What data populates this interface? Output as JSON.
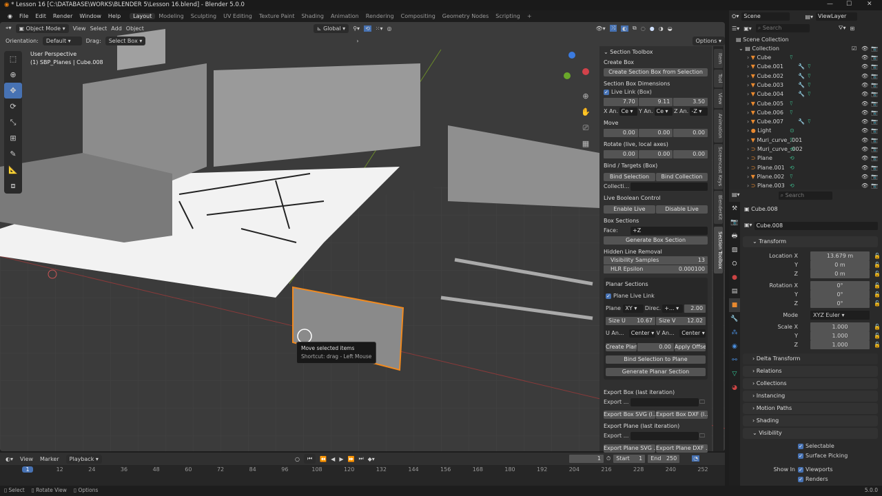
{
  "title": "* Lesson 16 [C:\\DATABASE\\WORKS\\BLENDER 5\\Lesson 16.blend] - Blender 5.0.0",
  "menu": [
    "File",
    "Edit",
    "Render",
    "Window",
    "Help"
  ],
  "workspaces": [
    "Layout",
    "Modeling",
    "Sculpting",
    "UV Editing",
    "Texture Paint",
    "Shading",
    "Animation",
    "Rendering",
    "Compositing",
    "Geometry Nodes",
    "Scripting",
    "+"
  ],
  "viewport": {
    "mode": "Object Mode",
    "menus": [
      "View",
      "Select",
      "Add",
      "Object"
    ],
    "transform_orientation": "Global",
    "orientation_label": "Orientation:",
    "orientation_value": "Default",
    "drag_label": "Drag:",
    "drag_value": "Select Box",
    "options": "Options",
    "view_name": "User Perspective",
    "view_info": "(1) SBP_Planes | Cube.008",
    "tooltip_title": "Move selected items",
    "tooltip_shortcut": "Shortcut: drag - Left Mouse"
  },
  "section_toolbox": {
    "title": "Section Toolbox",
    "create_box": "Create Box",
    "create_box_btn": "Create Section Box from Selection",
    "dims": "Section Box Dimensions",
    "live_link": "Live Link (Box)",
    "dim_values": [
      "7.70",
      "9.11",
      "3.50"
    ],
    "anchors": [
      {
        "label": "X An...",
        "value": "Ce"
      },
      {
        "label": "Y An...",
        "value": "Ce"
      },
      {
        "label": "Z An...",
        "value": "-Z"
      }
    ],
    "move": "Move",
    "move_values": [
      "0.00",
      "0.00",
      "0.00"
    ],
    "rotate": "Rotate (live, local axes)",
    "rotate_values": [
      "0.00",
      "0.00",
      "0.00"
    ],
    "bind": "Bind / Targets (Box)",
    "bind_selection": "Bind Selection",
    "bind_collection": "Bind Collection",
    "collection_label": "Collecti...",
    "live_bool": "Live Boolean Control",
    "enable_live": "Enable Live",
    "disable_live": "Disable Live",
    "box_sections": "Box Sections",
    "face_label": "Face:",
    "face_value": "+Z",
    "gen_box": "Generate Box Section",
    "hlr": "Hidden Line Removal",
    "vis_samples_label": "Visibility Samples",
    "vis_samples": "13",
    "hlr_eps_label": "HLR Epsilon",
    "hlr_eps": "0.000100",
    "planar": "Planar Sections",
    "plane_live": "Plane Live Link",
    "plane_label": "Plane:",
    "plane_value": "XY",
    "direc_label": "Direc...",
    "direc_value": "+...",
    "plane_offset": "2.00",
    "size_u_label": "Size U",
    "size_u": "10.67",
    "size_v_label": "Size V",
    "size_v": "12.02",
    "u_an": "U An...",
    "u_an_value": "Center",
    "v_an": "V An...",
    "v_an_value": "Center",
    "create_plane": "Create Plane",
    "create_plane_val": "0.00",
    "apply_offset": "Apply Offset",
    "bind_plane": "Bind Selection to Plane",
    "gen_planar": "Generate Planar Section",
    "export_box": "Export Box (last iteration)",
    "export_label": "Export ...",
    "export_box_svg": "Export Box SVG (l...",
    "export_box_dxf": "Export Box DXF (l...",
    "export_plane": "Export Plane (last iteration)",
    "export_plane_svg": "Export Plane SVG ...",
    "export_plane_dxf": "Export Plane DXF ..."
  },
  "sidebar_tabs": [
    "Item",
    "Tool",
    "View",
    "Animation",
    "Screencast Keys",
    "BlenderKit",
    "Section Toolbox"
  ],
  "outliner": {
    "scene": "Scene",
    "view_layer": "ViewLayer",
    "search_placeholder": "Search",
    "scene_collection": "Scene Collection",
    "collection": "Collection",
    "items": [
      {
        "name": "Cube",
        "icon": "mesh"
      },
      {
        "name": "Cube.001",
        "icon": "mesh"
      },
      {
        "name": "Cube.002",
        "icon": "mesh"
      },
      {
        "name": "Cube.003",
        "icon": "mesh"
      },
      {
        "name": "Cube.004",
        "icon": "mesh"
      },
      {
        "name": "Cube.005",
        "icon": "mesh"
      },
      {
        "name": "Cube.006",
        "icon": "mesh"
      },
      {
        "name": "Cube.007",
        "icon": "mesh"
      },
      {
        "name": "Light",
        "icon": "light"
      },
      {
        "name": "Muri_curve_.001",
        "icon": "mesh"
      },
      {
        "name": "Muri_curve_.002",
        "icon": "curve"
      },
      {
        "name": "Plane",
        "icon": "curve"
      },
      {
        "name": "Plane.001",
        "icon": "curve"
      },
      {
        "name": "Plane.002",
        "icon": "mesh"
      },
      {
        "name": "Plane.003",
        "icon": "curve"
      }
    ]
  },
  "properties": {
    "search_placeholder": "Search",
    "object_name": "Cube.008",
    "data_name": "Cube.008",
    "transform": "Transform",
    "location": [
      {
        "label": "Location X",
        "value": "13.679 m"
      },
      {
        "label": "Y",
        "value": "0 m"
      },
      {
        "label": "Z",
        "value": "0 m"
      }
    ],
    "rotation": [
      {
        "label": "Rotation X",
        "value": "0°"
      },
      {
        "label": "Y",
        "value": "0°"
      },
      {
        "label": "Z",
        "value": "0°"
      }
    ],
    "mode_label": "Mode",
    "mode_value": "XYZ Euler",
    "scale": [
      {
        "label": "Scale X",
        "value": "1.000"
      },
      {
        "label": "Y",
        "value": "1.000"
      },
      {
        "label": "Z",
        "value": "1.000"
      }
    ],
    "delta": "Delta Transform",
    "panels": [
      "Relations",
      "Collections",
      "Instancing",
      "Motion Paths",
      "Shading"
    ],
    "visibility": "Visibility",
    "selectable": "Selectable",
    "surface_picking": "Surface Picking",
    "show_in": "Show In",
    "viewports": "Viewports",
    "renders": "Renders"
  },
  "timeline": {
    "menus": [
      "View",
      "Marker",
      "Playback"
    ],
    "current_frame": "1",
    "start_label": "Start",
    "start": "1",
    "end_label": "End",
    "end": "250",
    "ticks": [
      "1",
      "12",
      "24",
      "36",
      "48",
      "60",
      "72",
      "84",
      "96",
      "108",
      "120",
      "132",
      "144",
      "156",
      "168",
      "180",
      "192",
      "204",
      "216",
      "228",
      "240",
      "252"
    ]
  },
  "statusbar": {
    "items": [
      "Select",
      "Rotate View",
      "Options"
    ],
    "version": "5.0.0"
  }
}
